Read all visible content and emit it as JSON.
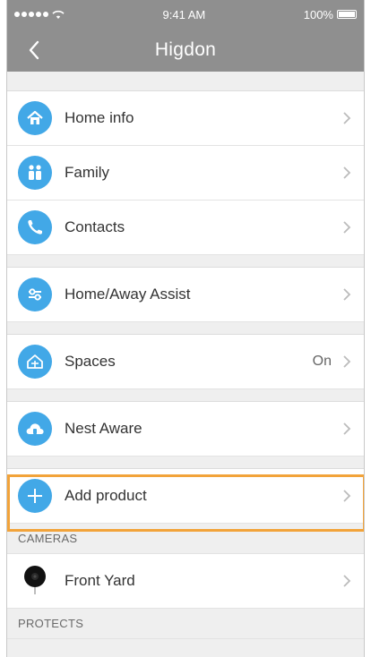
{
  "status_bar": {
    "signal": "•••••",
    "time": "9:41 AM",
    "battery": "100%"
  },
  "nav": {
    "title": "Higdon"
  },
  "rows": {
    "home_info": {
      "label": "Home info"
    },
    "family": {
      "label": "Family"
    },
    "contacts": {
      "label": "Contacts"
    },
    "home_away": {
      "label": "Home/Away Assist"
    },
    "spaces": {
      "label": "Spaces",
      "value": "On"
    },
    "nest_aware": {
      "label": "Nest Aware"
    },
    "add_product": {
      "label": "Add product"
    },
    "front_yard": {
      "label": "Front Yard"
    }
  },
  "sections": {
    "cameras": "CAMERAS",
    "protects": "PROTECTS"
  },
  "colors": {
    "accent": "#42a8e7",
    "nav_bg": "#8f8f8f",
    "highlight": "#f2a33a"
  },
  "icons": [
    "home-icon",
    "family-icon",
    "phone-icon",
    "sliders-icon",
    "house-spaces-icon",
    "cloud-icon",
    "plus-icon",
    "camera-icon"
  ]
}
